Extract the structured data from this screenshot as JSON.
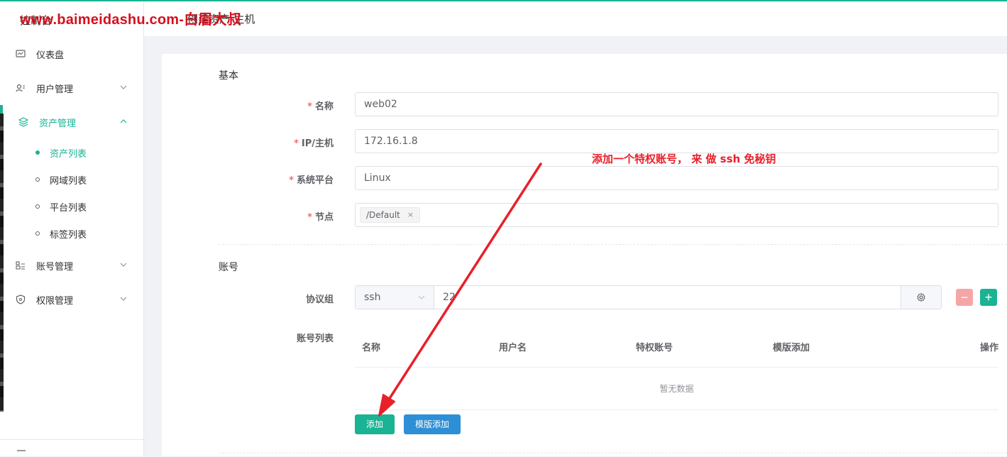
{
  "watermark": "www.baimeidashu.com-白眉大叔",
  "sidebar": {
    "console_label": "控制台",
    "items": [
      {
        "label": "仪表盘",
        "icon": "dashboard-icon"
      },
      {
        "label": "用户管理",
        "icon": "users-icon"
      },
      {
        "label": "资产管理",
        "icon": "layers-icon",
        "expanded": true,
        "children": [
          {
            "label": "资产列表",
            "active": true
          },
          {
            "label": "网域列表"
          },
          {
            "label": "平台列表"
          },
          {
            "label": "标签列表"
          }
        ]
      },
      {
        "label": "账号管理",
        "icon": "account-icon"
      },
      {
        "label": "权限管理",
        "icon": "shield-icon"
      }
    ]
  },
  "header": {
    "title": "创建资产-主机"
  },
  "form": {
    "basic_title": "基本",
    "fields": [
      {
        "label": "名称",
        "value": "web02",
        "required": true
      },
      {
        "label": "IP/主机",
        "value": "172.16.1.8",
        "required": true
      },
      {
        "label": "系统平台",
        "value": "Linux",
        "required": true
      },
      {
        "label": "节点",
        "tag": "/Default",
        "tag_close": "×",
        "required": true
      }
    ],
    "account_title": "账号",
    "protocol_label": "协议组",
    "protocol": {
      "name": "ssh",
      "port": "22"
    },
    "account_list_label": "账号列表",
    "table": {
      "headers": [
        "名称",
        "用户名",
        "特权账号",
        "模版添加",
        "操作"
      ],
      "empty_text": "暂无数据"
    },
    "add_button": "添加",
    "template_add_button": "模版添加"
  },
  "annotation": "添加一个特权账号， 来 做 ssh 免秘钥",
  "colors": {
    "accent": "#1ab394",
    "danger": "#f56c6c",
    "primary": "#2d8fd5",
    "annotation": "#e8202a"
  }
}
